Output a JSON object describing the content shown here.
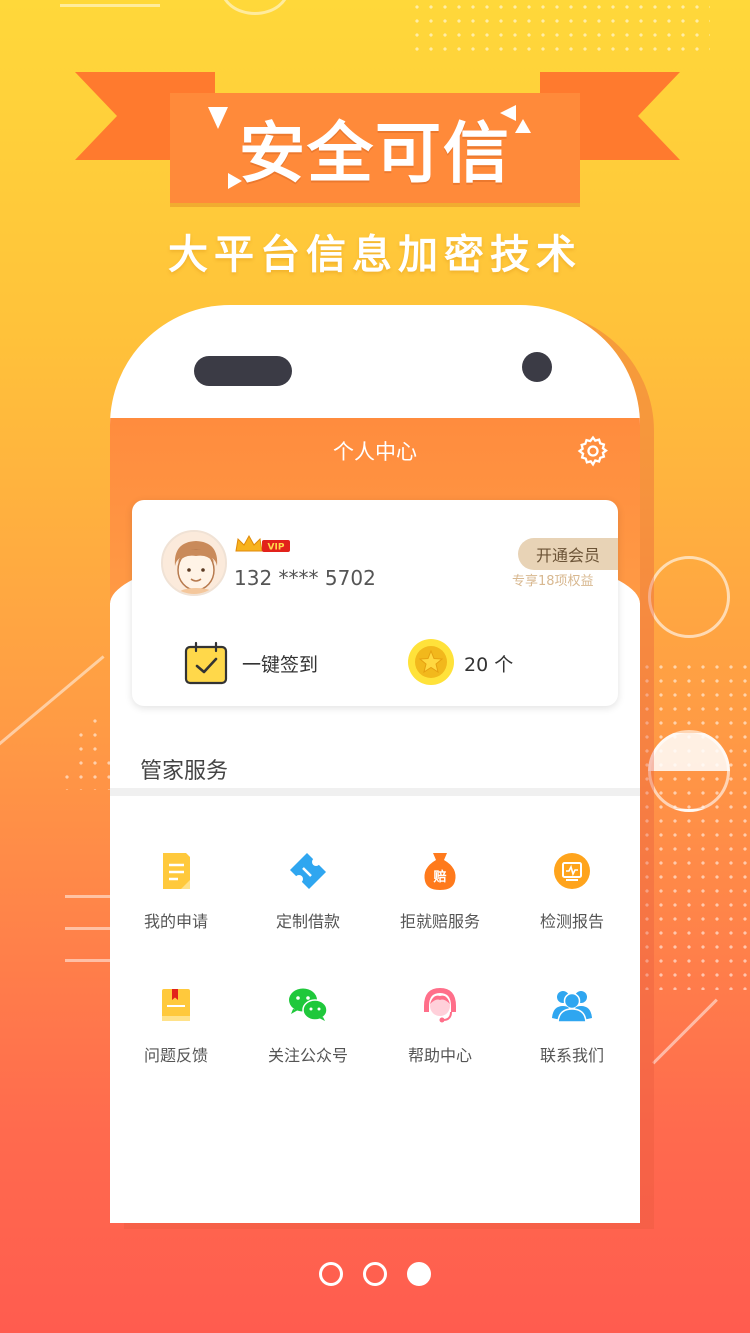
{
  "banner": {
    "title": "安全可信",
    "subtitle": "大平台信息加密技术"
  },
  "screen": {
    "title": "个人中心",
    "settings_icon": "gear-icon"
  },
  "profile": {
    "badge": "VIP",
    "phone": "132 **** 5702",
    "member_button": "开通会员",
    "member_sub": "专享18项权益",
    "signin_label": "一键签到",
    "coin_label": "20 个"
  },
  "services": {
    "section_title": "管家服务",
    "items": [
      {
        "label": "我的申请",
        "icon": "document-icon",
        "color": "#ffc93c"
      },
      {
        "label": "定制借款",
        "icon": "ticket-icon",
        "color": "#2fa6f0"
      },
      {
        "label": "拒就赔服务",
        "icon": "money-bag-icon",
        "color": "#ff7a1c"
      },
      {
        "label": "检测报告",
        "icon": "report-icon",
        "color": "#ffa41c"
      },
      {
        "label": "问题反馈",
        "icon": "book-icon",
        "color": "#ffc93c"
      },
      {
        "label": "关注公众号",
        "icon": "wechat-icon",
        "color": "#1fc83b"
      },
      {
        "label": "帮助中心",
        "icon": "support-agent-icon",
        "color": "#ff6f8a"
      },
      {
        "label": "联系我们",
        "icon": "users-icon",
        "color": "#2fa6f0"
      }
    ]
  },
  "pagination": {
    "count": 3,
    "active": 3
  }
}
